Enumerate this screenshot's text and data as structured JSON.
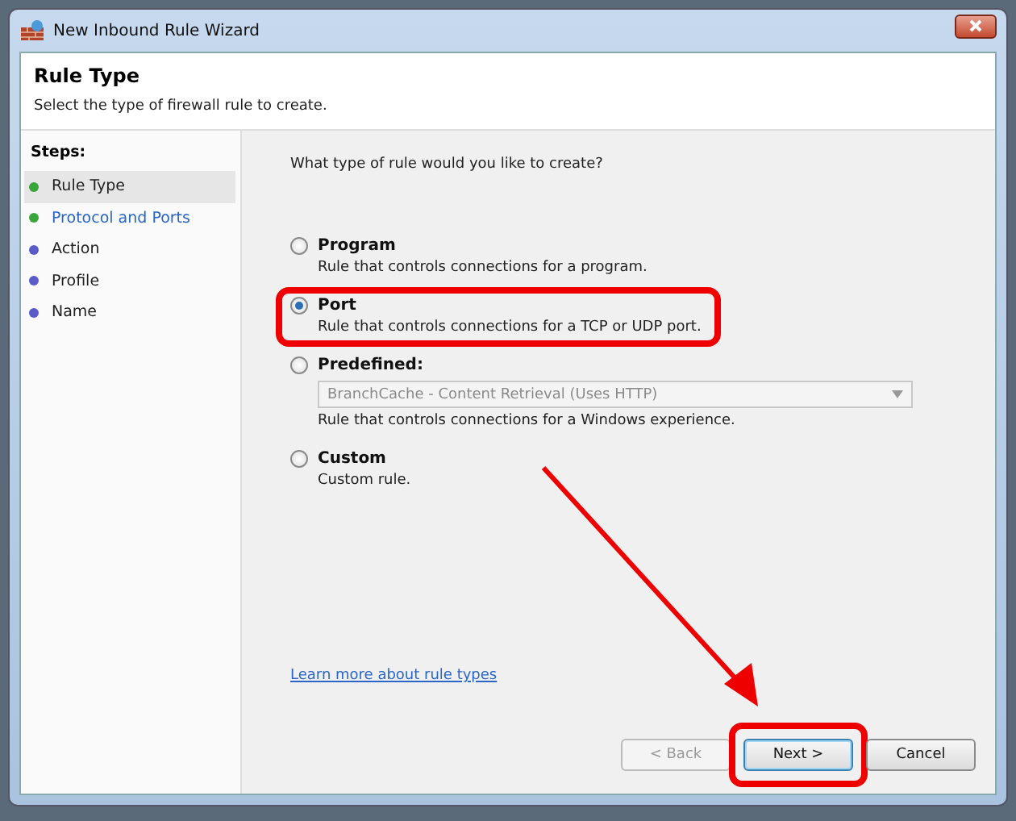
{
  "window": {
    "title": "New Inbound Rule Wizard"
  },
  "header": {
    "title": "Rule Type",
    "subtitle": "Select the type of firewall rule to create."
  },
  "steps": {
    "heading": "Steps:",
    "items": [
      {
        "label": "Rule Type",
        "color": "#3aa53a",
        "selected": true,
        "link": false
      },
      {
        "label": "Protocol and Ports",
        "color": "#3aa53a",
        "selected": false,
        "link": true
      },
      {
        "label": "Action",
        "color": "#5a5ac8",
        "selected": false,
        "link": false
      },
      {
        "label": "Profile",
        "color": "#5a5ac8",
        "selected": false,
        "link": false
      },
      {
        "label": "Name",
        "color": "#5a5ac8",
        "selected": false,
        "link": false
      }
    ]
  },
  "question": "What type of rule would you like to create?",
  "options": [
    {
      "label": "Program",
      "description": "Rule that controls connections for a program.",
      "selected": false
    },
    {
      "label": "Port",
      "description": "Rule that controls connections for a TCP or UDP port.",
      "selected": true,
      "highlighted": true
    },
    {
      "label": "Predefined:",
      "description": "Rule that controls connections for a Windows experience.",
      "selected": false,
      "dropdown": {
        "value": "BranchCache - Content Retrieval (Uses HTTP)",
        "disabled": true
      }
    },
    {
      "label": "Custom",
      "description": "Custom rule.",
      "selected": false
    }
  ],
  "help_link": "Learn more about rule types",
  "buttons": [
    {
      "label": "< Back",
      "disabled": true,
      "default": false
    },
    {
      "label": "Next >",
      "disabled": false,
      "default": true,
      "highlighted": true
    },
    {
      "label": "Cancel",
      "disabled": false,
      "default": false
    }
  ]
}
